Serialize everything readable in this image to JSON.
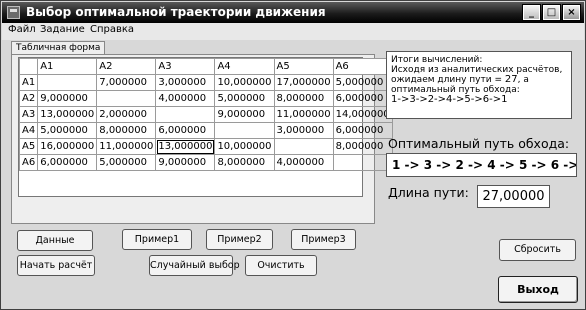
{
  "window": {
    "title": "Выбор оптимальной траектории движения",
    "controls": {
      "minimize": "_",
      "maximize": "□",
      "close": "×"
    }
  },
  "menu": [
    "Файл",
    "Задание",
    "Справка"
  ],
  "tab": {
    "label": "Табличная форма"
  },
  "table": {
    "columns": [
      "",
      "A1",
      "A2",
      "A3",
      "A4",
      "A5",
      "A6"
    ],
    "rows": [
      {
        "label": "A1",
        "cells": [
          "",
          "7,000000",
          "3,000000",
          "10,000000",
          "17,000000",
          "5,000000"
        ]
      },
      {
        "label": "A2",
        "cells": [
          "9,000000",
          "",
          "4,000000",
          "5,000000",
          "8,000000",
          "6,000000"
        ]
      },
      {
        "label": "A3",
        "cells": [
          "13,000000",
          "2,000000",
          "",
          "9,000000",
          "11,000000",
          "14,000000"
        ]
      },
      {
        "label": "A4",
        "cells": [
          "5,000000",
          "8,000000",
          "6,000000",
          "",
          "3,000000",
          "6,000000"
        ]
      },
      {
        "label": "A5",
        "cells": [
          "16,000000",
          "11,000000",
          "13,000000",
          "10,000000",
          "",
          "8,000000"
        ]
      },
      {
        "label": "A6",
        "cells": [
          "6,000000",
          "5,000000",
          "9,000000",
          "8,000000",
          "4,000000",
          ""
        ]
      }
    ]
  },
  "result": {
    "line1": "Итоги вычислений:",
    "line2": "Исходя из аналитических расчётов,",
    "line3_prefix": "ожидаем длину пути = ",
    "line3_value": "27",
    "line3_suffix": ", а",
    "line4": "оптимальный путь обхода:",
    "path": "1->3->2->4->5->6->1"
  },
  "optimal": {
    "label": "Оптимальный путь обхода:",
    "value": "1 -> 3 -> 2 -> 4 -> 5 -> 6 ->"
  },
  "length": {
    "label": "Длина пути:",
    "value": "27,00000"
  },
  "buttons": {
    "data": "Данные",
    "example1": "Пример1",
    "example2": "Пример2",
    "example3": "Пример3",
    "start": "Начать расчёт",
    "random": "Случайный выбор",
    "clear": "Очистить",
    "reset": "Сбросить",
    "exit": "Выход"
  }
}
